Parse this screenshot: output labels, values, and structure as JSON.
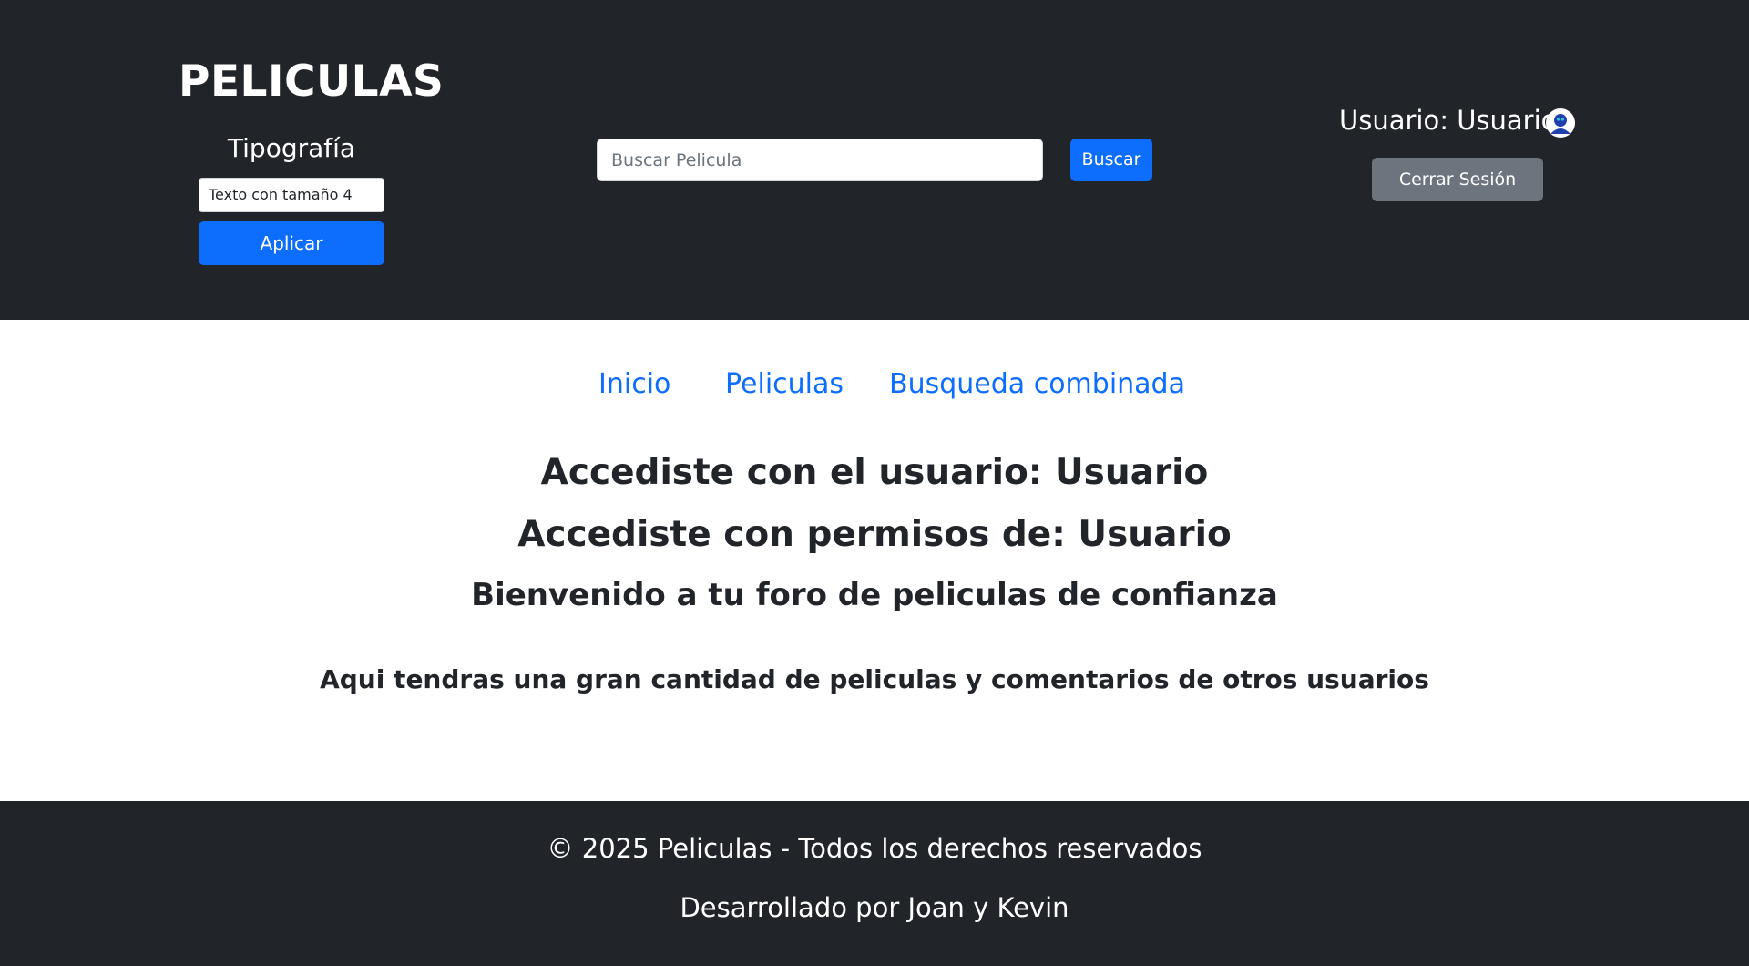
{
  "header": {
    "brand": "PELICULAS",
    "typography": {
      "title": "Tipografía",
      "selected_option": "Texto con tamaño 4",
      "apply_label": "Aplicar"
    },
    "search": {
      "placeholder": "Buscar Pelicula",
      "value": "",
      "button_label": "Buscar"
    },
    "user": {
      "label": "Usuario: Usuario",
      "avatar_icon": "user-avatar-icon",
      "logout_label": "Cerrar Sesión"
    }
  },
  "nav": {
    "items": [
      {
        "label": "Inicio"
      },
      {
        "label": "Peliculas"
      },
      {
        "label": "Busqueda combinada"
      }
    ]
  },
  "main": {
    "user_line": "Accediste con el usuario: Usuario",
    "permission_line": "Accediste con permisos de: Usuario",
    "welcome": "Bienvenido a tu foro de peliculas de confianza",
    "intro": "Aqui tendras una gran cantidad de peliculas y comentarios de otros usuarios"
  },
  "footer": {
    "copyright": "© 2025 Peliculas - Todos los derechos reservados",
    "developers": "Desarrollado por Joan y Kevin"
  },
  "colors": {
    "header_bg": "#212529",
    "primary": "#0d6efd",
    "secondary": "#6c757d"
  }
}
